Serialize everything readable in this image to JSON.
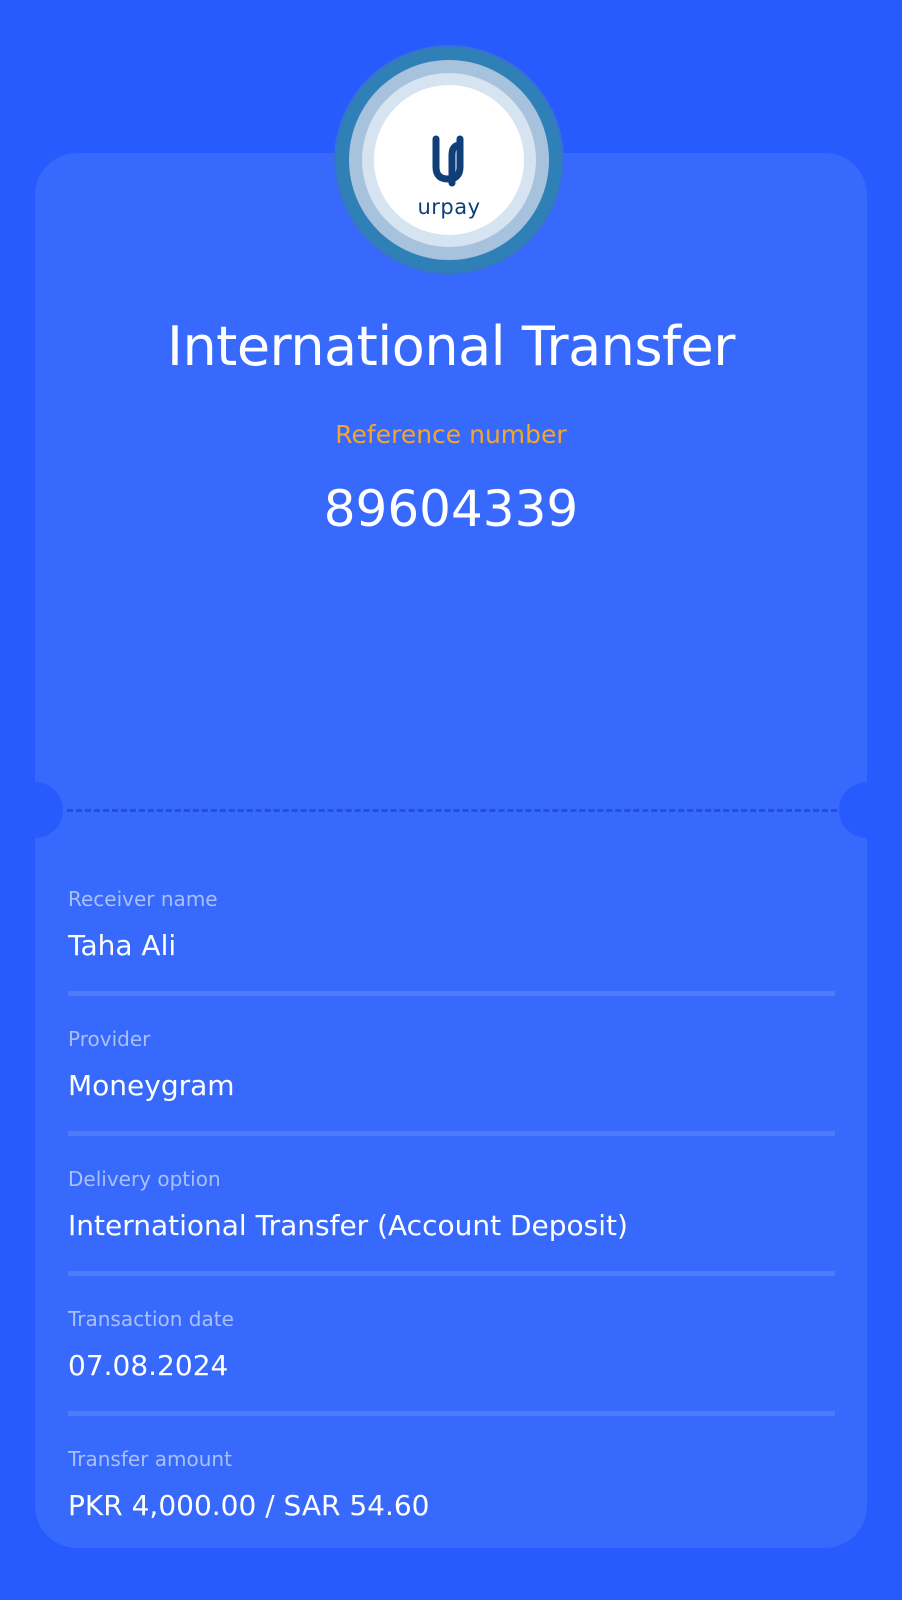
{
  "logo": {
    "text": "urpay"
  },
  "transfer": {
    "title": "International Transfer",
    "reference_label": "Reference number",
    "reference_value": "89604339"
  },
  "details": [
    {
      "label": "Receiver name",
      "value": "Taha Ali"
    },
    {
      "label": "Provider",
      "value": "Moneygram"
    },
    {
      "label": "Delivery option",
      "value": "International Transfer (Account Deposit)"
    },
    {
      "label": "Transaction date",
      "value": "07.08.2024"
    },
    {
      "label": "Transfer amount",
      "value": "PKR 4,000.00 / SAR 54.60"
    }
  ],
  "colors": {
    "background": "#275bfd",
    "card": "#3769fd",
    "accent_label": "#f4a62a",
    "logo_brand": "#0f3e78"
  }
}
